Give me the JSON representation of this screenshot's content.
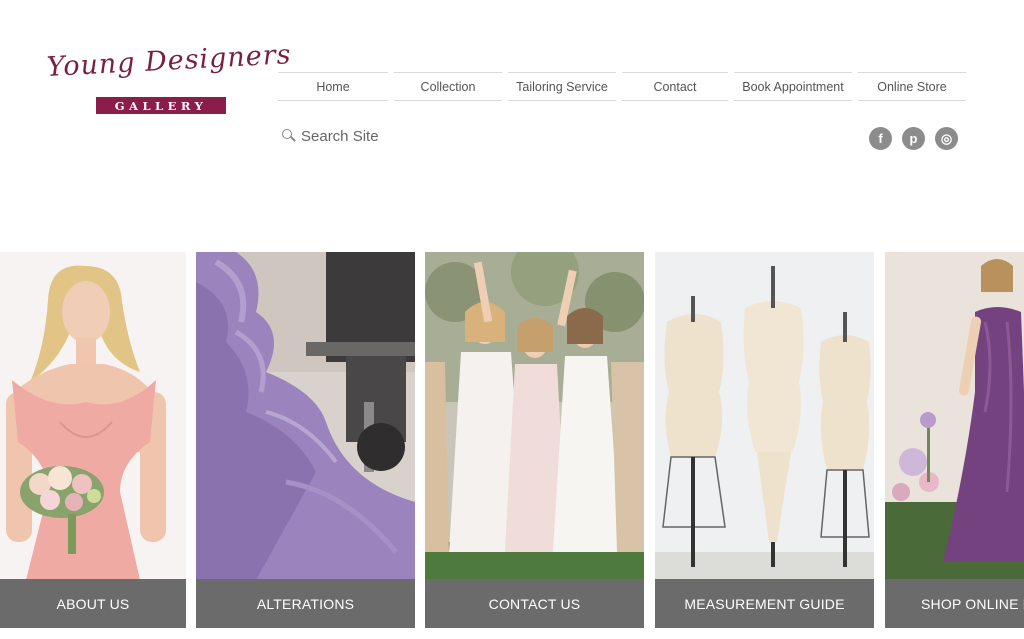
{
  "logo": {
    "script_text": "Young Designers",
    "bar_text": "GALLERY"
  },
  "nav": {
    "items": [
      "Home",
      "Collection",
      "Tailoring Service",
      "Contact",
      "Book Appointment",
      "Online Store"
    ]
  },
  "search": {
    "placeholder": "Search Site",
    "icon": "magnifier-icon"
  },
  "social": {
    "items": [
      {
        "name": "facebook-icon",
        "glyph": "f"
      },
      {
        "name": "pinterest-icon",
        "glyph": "p"
      },
      {
        "name": "instagram-icon",
        "glyph": "◎"
      }
    ]
  },
  "tiles": [
    {
      "label": "ABOUT US",
      "image": "bridesmaid-in-blush-dress-with-bouquet"
    },
    {
      "label": "ALTERATIONS",
      "image": "lavender-fabric-on-sewing-machine"
    },
    {
      "label": "CONTACT US",
      "image": "bridesmaids-celebrating-outdoors"
    },
    {
      "label": "MEASUREMENT GUIDE",
      "image": "three-dress-forms"
    },
    {
      "label": "SHOP ONLINE FO",
      "image": "woman-in-purple-gown"
    }
  ],
  "colors": {
    "brand": "#8a1d4a",
    "tile_label_bg": "#6b6b6b",
    "social_icon_bg": "#8c8c8c"
  }
}
